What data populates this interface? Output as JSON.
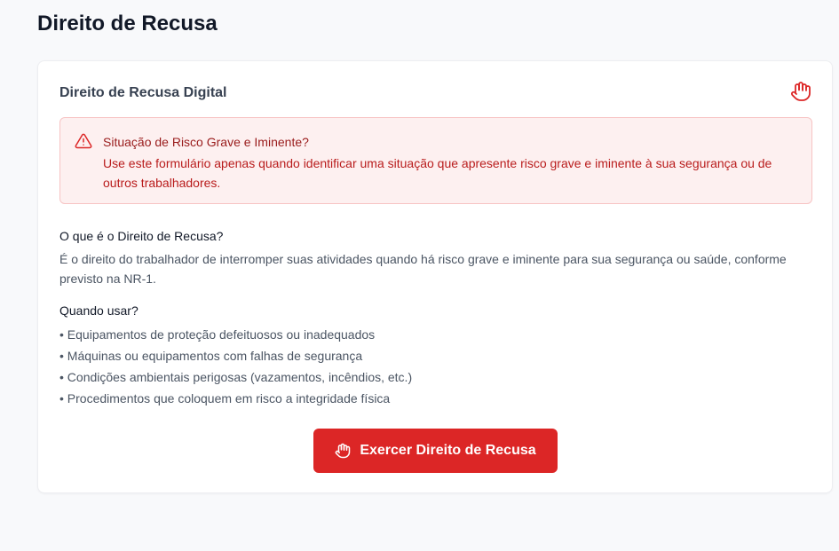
{
  "page": {
    "title": "Direito de Recusa"
  },
  "card": {
    "title": "Direito de Recusa Digital",
    "header_icon": "hand-icon"
  },
  "alert": {
    "icon": "warning-triangle-icon",
    "title": "Situação de Risco Grave e Iminente?",
    "text": "Use este formulário apenas quando identificar uma situação que apresente risco grave e iminente à sua segurança ou de outros trabalhadores.",
    "colors": {
      "background": "#fdf0f0",
      "border": "#f7c4c4",
      "text": "#b91c1c"
    }
  },
  "info": {
    "heading": "O que é o Direito de Recusa?",
    "text": "É o direito do trabalhador de interromper suas atividades quando há risco grave e iminente para sua segurança ou saúde, conforme previsto na NR-1."
  },
  "usage": {
    "heading": "Quando usar?",
    "items": [
      "Equipamentos de proteção defeituosos ou inadequados",
      "Máquinas ou equipamentos com falhas de segurança",
      "Condições ambientais perigosas (vazamentos, incêndios, etc.)",
      "Procedimentos que coloquem em risco a integridade física"
    ]
  },
  "action": {
    "label": "Exercer Direito de Recusa",
    "icon": "hand-icon",
    "color": "#dc2626"
  }
}
